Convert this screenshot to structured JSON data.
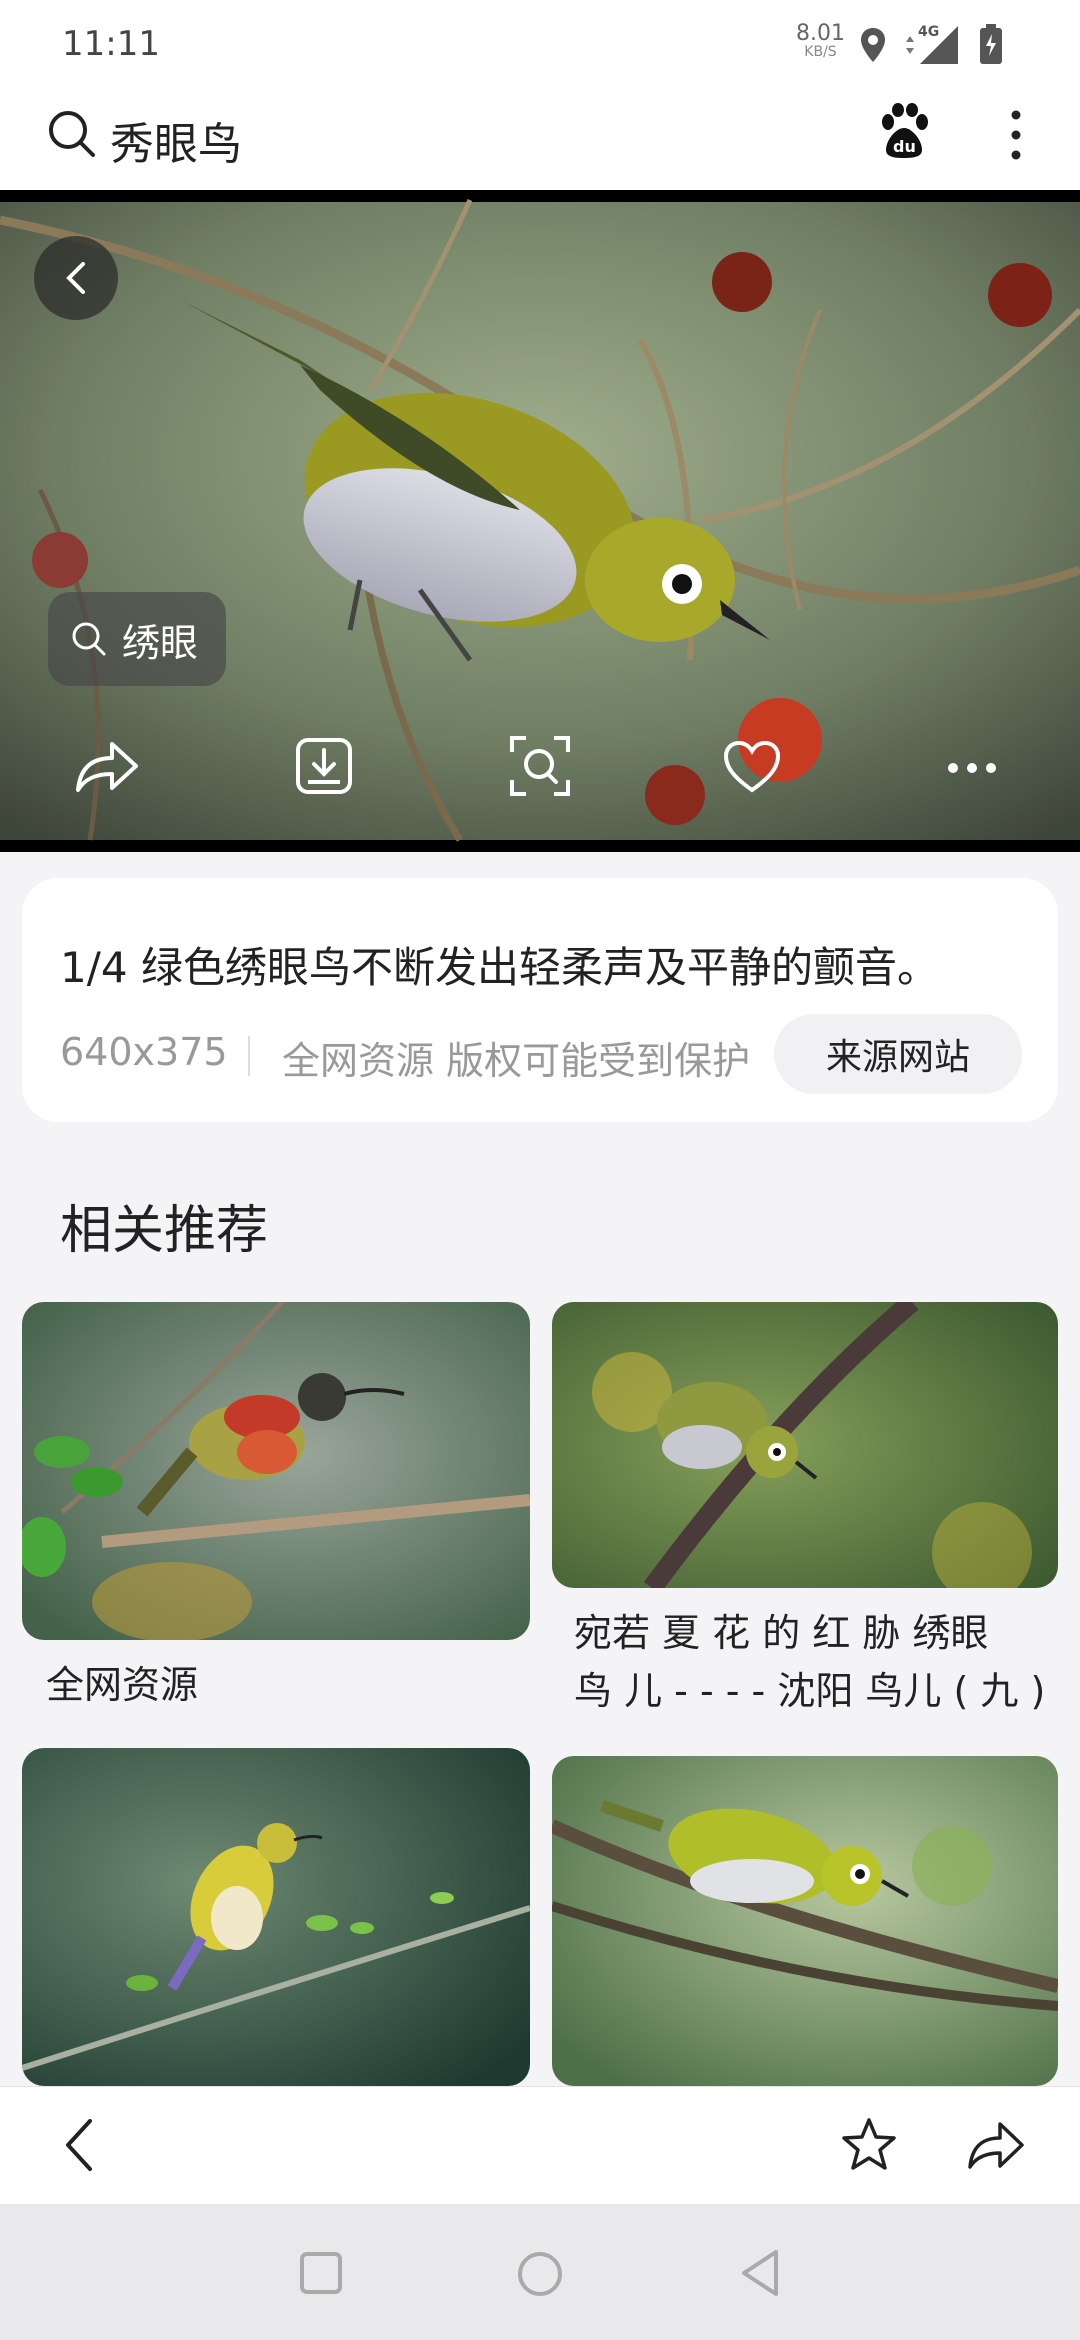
{
  "status_bar": {
    "time": "11:11",
    "net_speed_value": "8.01",
    "net_speed_unit": "KB/S",
    "network_type": "4G"
  },
  "search": {
    "query": "秀眼鸟"
  },
  "image_viewer": {
    "related_chip_label": "绣眼",
    "actions": [
      "share",
      "download",
      "scan",
      "favorite",
      "more"
    ]
  },
  "info_card": {
    "caption": "1/4 绿色绣眼鸟不断发出轻柔声及平静的颤音。",
    "dimensions": "640x375",
    "copyright_note": "全网资源 版权可能受到保护",
    "source_button": "来源网站"
  },
  "related": {
    "title": "相关推荐",
    "items": [
      {
        "caption": "全网资源"
      },
      {
        "caption_line1": "宛若 夏 花 的 红 胁 绣眼",
        "caption_line2": "鸟 儿 - - - - 沈阳 鸟儿 ( 九 )"
      }
    ]
  },
  "colors": {
    "accent_yellow_green": "#a8a82a",
    "card_bg": "#ffffff",
    "page_bg": "#f4f4f6"
  }
}
